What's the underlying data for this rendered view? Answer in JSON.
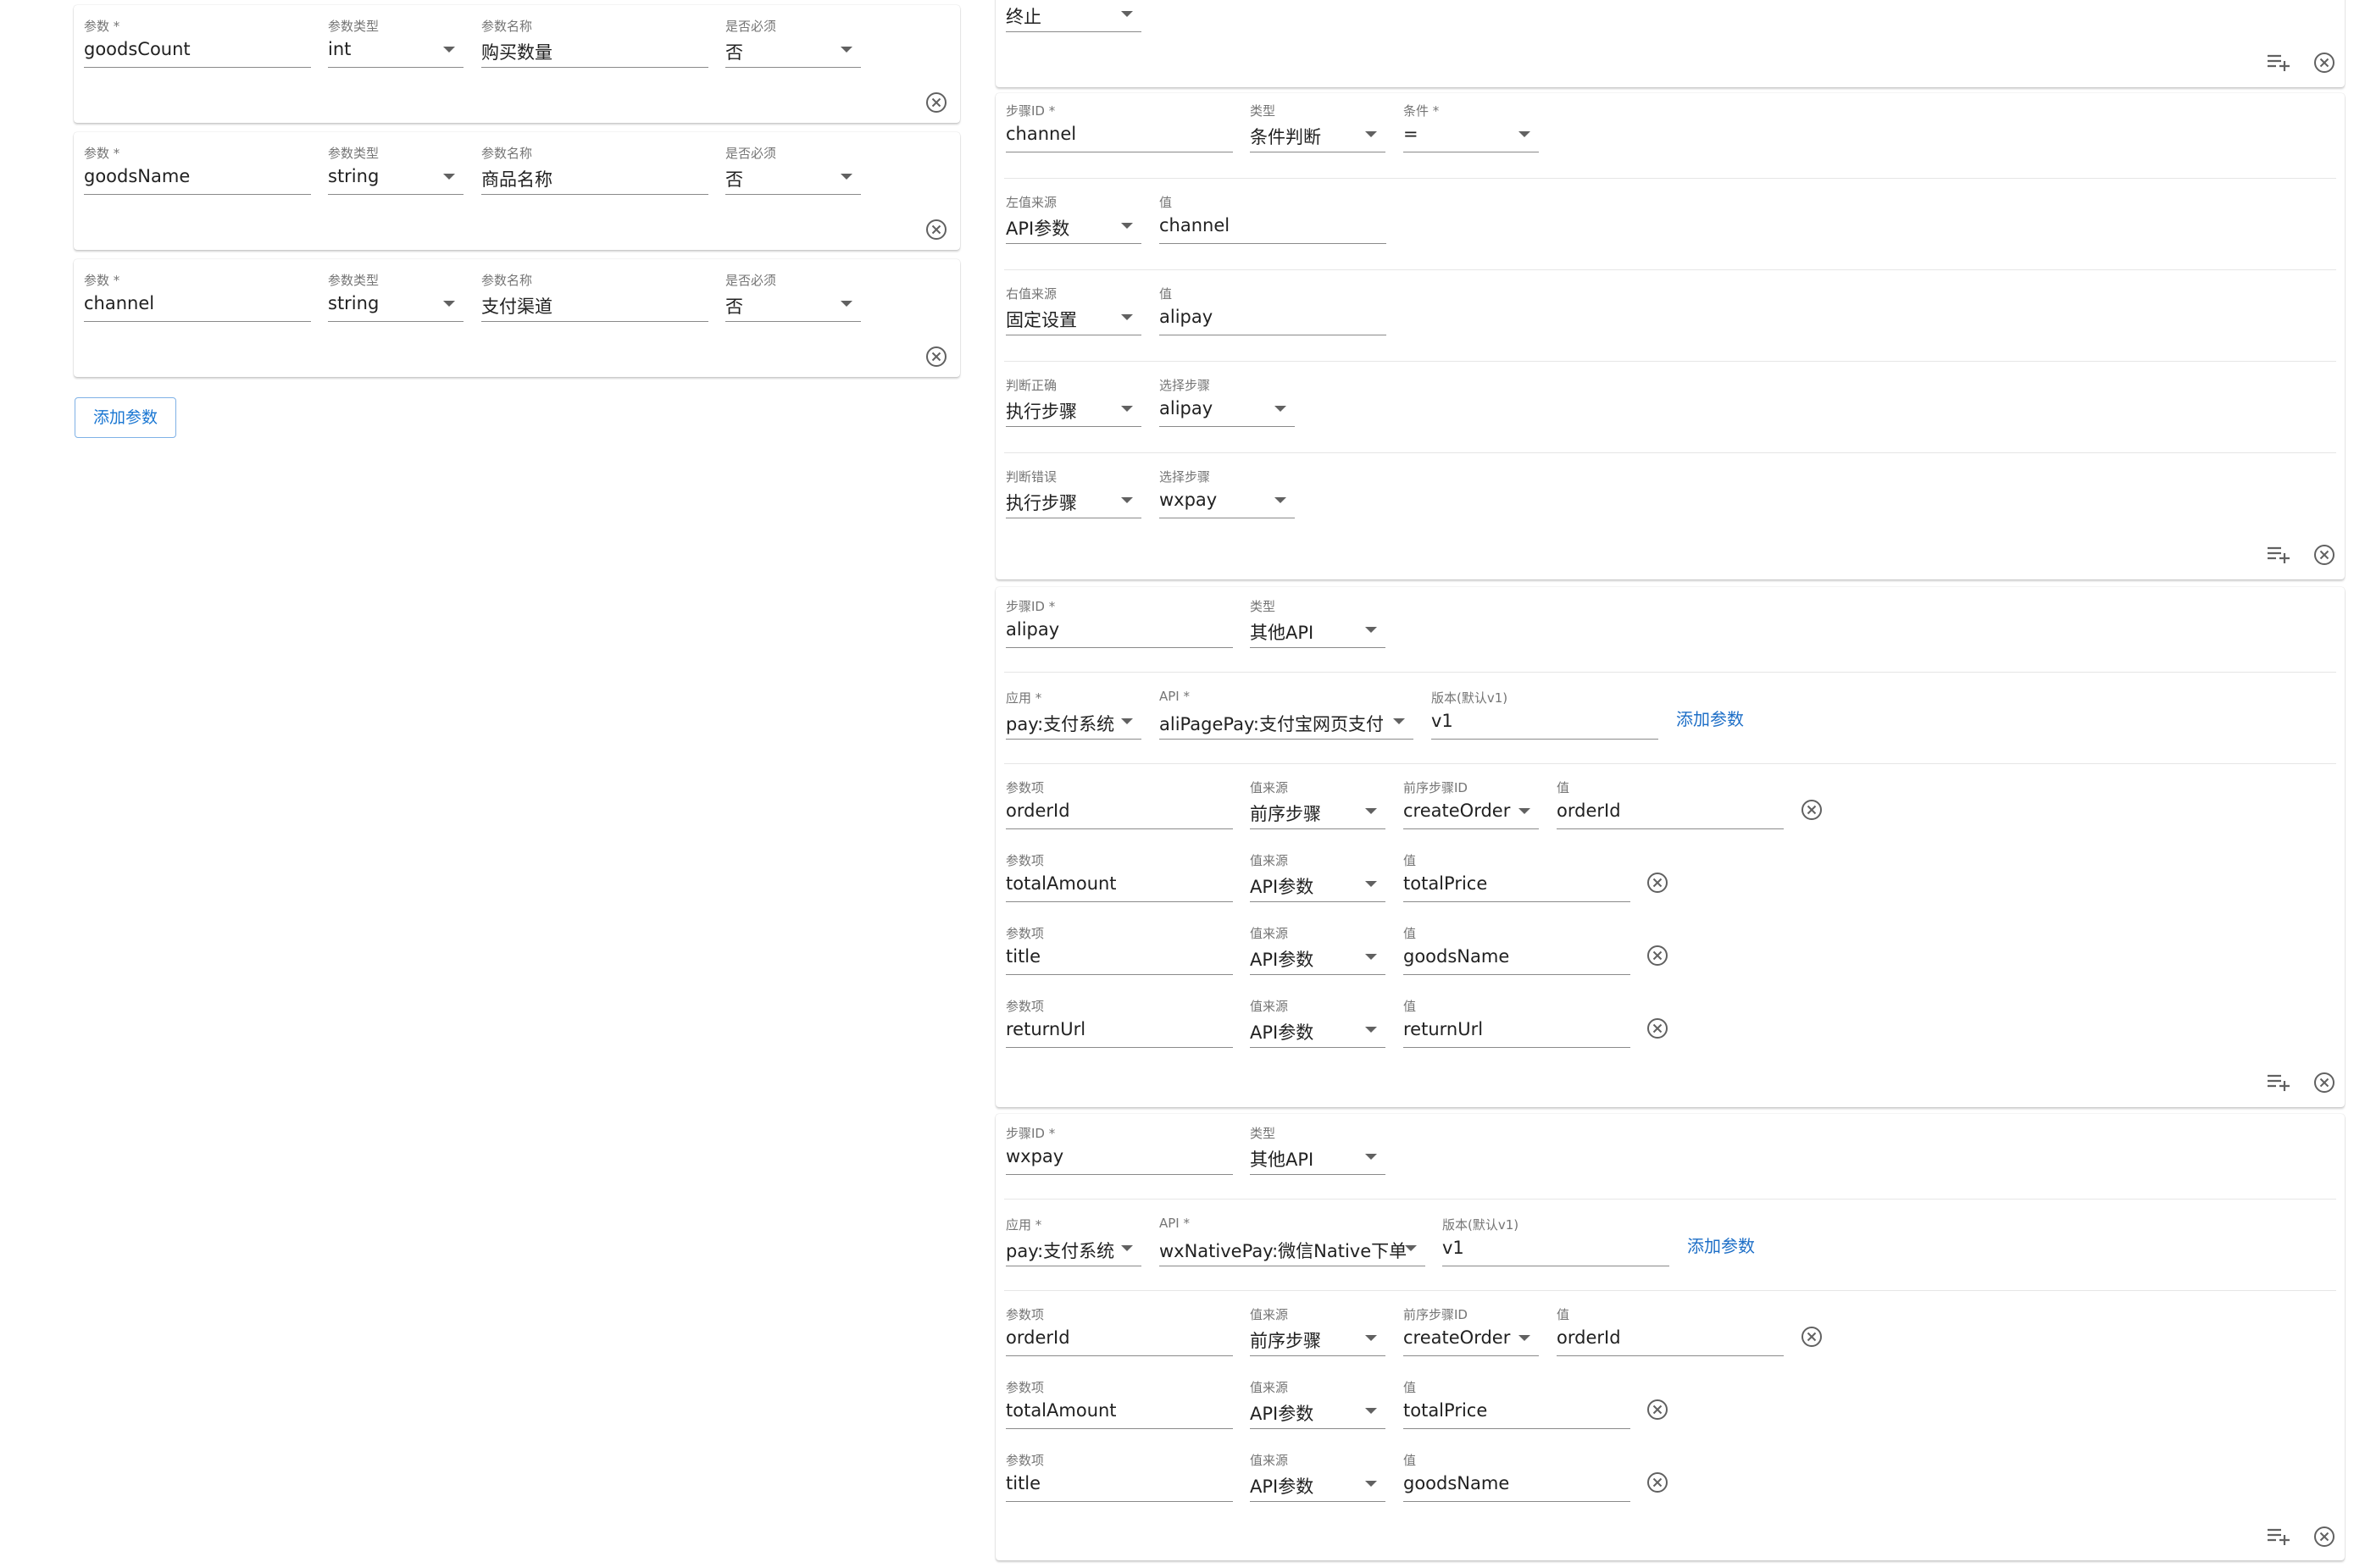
{
  "left": {
    "params": [
      {
        "param_label": "参数 *",
        "param": "goodsCount",
        "type_label": "参数类型",
        "type": "int",
        "name_label": "参数名称",
        "name": "购买数量",
        "req_label": "是否必须",
        "required": "否"
      },
      {
        "param_label": "参数 *",
        "param": "goodsName",
        "type_label": "参数类型",
        "type": "string",
        "name_label": "参数名称",
        "name": "商品名称",
        "req_label": "是否必须",
        "required": "否"
      },
      {
        "param_label": "参数 *",
        "param": "channel",
        "type_label": "参数类型",
        "type": "string",
        "name_label": "参数名称",
        "name": "支付渠道",
        "req_label": "是否必须",
        "required": "否"
      }
    ],
    "add_param_label": "添加参数"
  },
  "right": {
    "top": {
      "value": "终止"
    },
    "cond": {
      "step_id_label": "步骤ID *",
      "step_id": "channel",
      "type_label": "类型",
      "type": "条件判断",
      "cond_label": "条件 *",
      "cond": "=",
      "rows": [
        {
          "src_label": "左值来源",
          "src": "API参数",
          "val_label": "值",
          "val": "channel"
        },
        {
          "src_label": "右值来源",
          "src": "固定设置",
          "val_label": "值",
          "val": "alipay"
        },
        {
          "src_label": "判断正确",
          "src": "执行步骤",
          "val_label": "选择步骤",
          "val": "alipay"
        },
        {
          "src_label": "判断错误",
          "src": "执行步骤",
          "val_label": "选择步骤",
          "val": "wxpay"
        }
      ]
    },
    "alipay": {
      "step_id_label": "步骤ID *",
      "step_id": "alipay",
      "type_label": "类型",
      "type": "其他API",
      "app_label": "应用 *",
      "app": "pay:支付系统",
      "api_label": "API *",
      "api": "aliPagePay:支付宝网页支付",
      "ver_label": "版本(默认v1)",
      "ver": "v1",
      "add_param": "添加参数",
      "items": [
        {
          "item_label": "参数项",
          "item": "orderId",
          "src_label": "值来源",
          "src": "前序步骤",
          "prev_label": "前序步骤ID",
          "prev": "createOrder",
          "val_label": "值",
          "val": "orderId"
        },
        {
          "item_label": "参数项",
          "item": "totalAmount",
          "src_label": "值来源",
          "src": "API参数",
          "val_label": "值",
          "val": "totalPrice"
        },
        {
          "item_label": "参数项",
          "item": "title",
          "src_label": "值来源",
          "src": "API参数",
          "val_label": "值",
          "val": "goodsName"
        },
        {
          "item_label": "参数项",
          "item": "returnUrl",
          "src_label": "值来源",
          "src": "API参数",
          "val_label": "值",
          "val": "returnUrl"
        }
      ]
    },
    "wxpay": {
      "step_id_label": "步骤ID *",
      "step_id": "wxpay",
      "type_label": "类型",
      "type": "其他API",
      "app_label": "应用 *",
      "app": "pay:支付系统",
      "api_label": "API *",
      "api": "wxNativePay:微信Native下单",
      "ver_label": "版本(默认v1)",
      "ver": "v1",
      "add_param": "添加参数",
      "items": [
        {
          "item_label": "参数项",
          "item": "orderId",
          "src_label": "值来源",
          "src": "前序步骤",
          "prev_label": "前序步骤ID",
          "prev": "createOrder",
          "val_label": "值",
          "val": "orderId"
        },
        {
          "item_label": "参数项",
          "item": "totalAmount",
          "src_label": "值来源",
          "src": "API参数",
          "val_label": "值",
          "val": "totalPrice"
        },
        {
          "item_label": "参数项",
          "item": "title",
          "src_label": "值来源",
          "src": "API参数",
          "val_label": "值",
          "val": "goodsName"
        }
      ]
    }
  }
}
